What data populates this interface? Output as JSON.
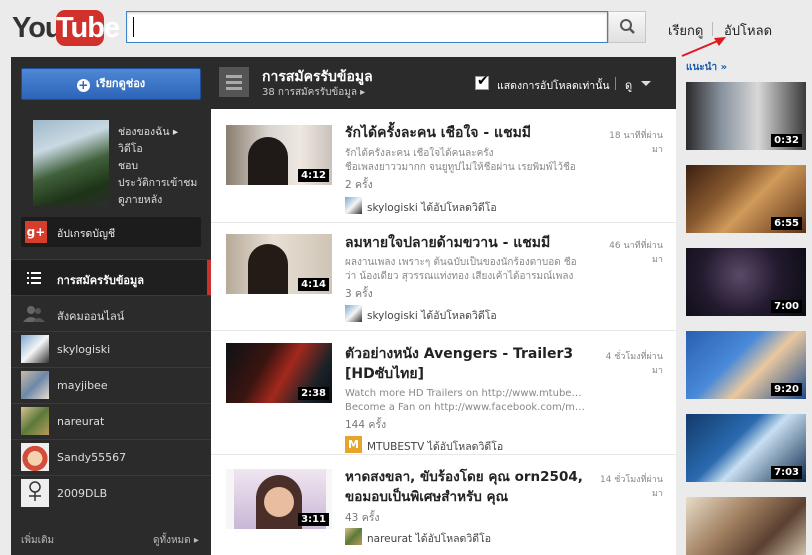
{
  "header": {
    "logo_you": "You",
    "logo_tube": "Tube",
    "search_value": "",
    "browse_link": "เรียกดู",
    "upload_link": "อัปโหลด"
  },
  "sidebar": {
    "browse_channels_button": "เรียกดูช่อง",
    "profile_links": [
      "ช่องของฉัน ▸",
      "วิดีโอ",
      "ชอบ",
      "ประวัติการเข้าชม",
      "ดูภายหลัง"
    ],
    "upgrade_account": "อัปเกรดบัญชี",
    "nav": {
      "subscriptions": "การสมัครรับข้อมูล",
      "social": "สังคมออนไลน์"
    },
    "channels": [
      "skylogiski",
      "mayjibee",
      "nareurat",
      "Sandy55567",
      "2009DLB"
    ],
    "more": "เพิ่มเติม",
    "see_all": "ดูทั้งหมด ▸"
  },
  "main": {
    "title": "การสมัครรับข้อมูล",
    "count": "38 การสมัครรับข้อมูล ▸",
    "only_uploads": "แสดงการอัปโหลดเท่านั้น",
    "view_label": "ดู",
    "videos": [
      {
        "title": "รักได้ครั้งละคน เชือใจ - แชมมี",
        "time": "18 นาทีที่ผ่านมา",
        "desc1": "รักได้ครั้งละคน เชือใจได้คนละครั้ง",
        "desc2": "ชื่อเพลงยาววมากก จนยูทูปไม่ให้ชื่อผ่าน เรยพิมพ์ไว้ชื่อ",
        "views": "2 ครั้ง",
        "uploader": "skylogiski ได้อัปโหลดวิดีโอ",
        "duration": "4:12"
      },
      {
        "title": "ลมหายใจปลายด้ามขวาน - แชมมี",
        "time": "46 นาทีที่ผ่านมา",
        "desc1": "ผลงานเพลง เพราะๆ ต้นฉบับเป็นของนักร้องดาบอด ชื่อ",
        "desc2": "ว่า น้องเดียว สุวรรณแท่งทอง เสียงเค้าได้อารมณ์เพลง",
        "views": "3 ครั้ง",
        "uploader": "skylogiski ได้อัปโหลดวิดีโอ",
        "duration": "4:14"
      },
      {
        "title": "ตัวอย่างหนัง Avengers - Trailer3 [HDซับไทย]",
        "time": "4 ชั่วโมงที่ผ่านมา",
        "desc1": "Watch more HD Trailers on http://www.mtubes.tv",
        "desc2": "Become a Fan on http://www.facebook.com/mtu...",
        "views": "144 ครั้ง",
        "uploader": "MTUBESTV ได้อัปโหลดวิดีโอ",
        "duration": "2:38"
      },
      {
        "title": "หาดสงขลา, ขับร้องโดย คุณ orn2504, ขอมอบเป็นพิเศษสำหรับ คุณ",
        "time": "14 ชั่วโมงที่ผ่านมา",
        "desc1": "",
        "desc2": "",
        "views": "43 ครั้ง",
        "uploader": "nareurat ได้อัปโหลดวิดีโอ",
        "duration": "3:11"
      }
    ]
  },
  "recommended": {
    "label": "แนะนำ »",
    "durations": [
      "0:32",
      "6:55",
      "7:00",
      "9:20",
      "7:03",
      ""
    ]
  }
}
